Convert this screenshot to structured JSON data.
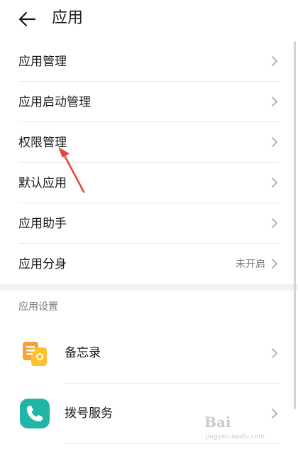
{
  "header": {
    "title": "应用",
    "back_icon": "arrow-left-icon"
  },
  "menu": [
    {
      "label": "应用管理",
      "value": ""
    },
    {
      "label": "应用启动管理",
      "value": ""
    },
    {
      "label": "权限管理",
      "value": ""
    },
    {
      "label": "默认应用",
      "value": ""
    },
    {
      "label": "应用助手",
      "value": ""
    },
    {
      "label": "应用分身",
      "value": "未开启"
    }
  ],
  "section": {
    "title": "应用设置"
  },
  "apps": [
    {
      "label": "备忘录",
      "icon": "notepad-icon",
      "color": "#f39a2c"
    },
    {
      "label": "拨号服务",
      "icon": "phone-icon",
      "color": "#1fb6a8"
    }
  ],
  "colors": {
    "annotation_arrow": "#e8453c",
    "divider": "#e9e9e9",
    "secondary_text": "#7b7b7b"
  },
  "watermark": {
    "brand": "Bai",
    "sub": "jingyan.baidu.com"
  }
}
